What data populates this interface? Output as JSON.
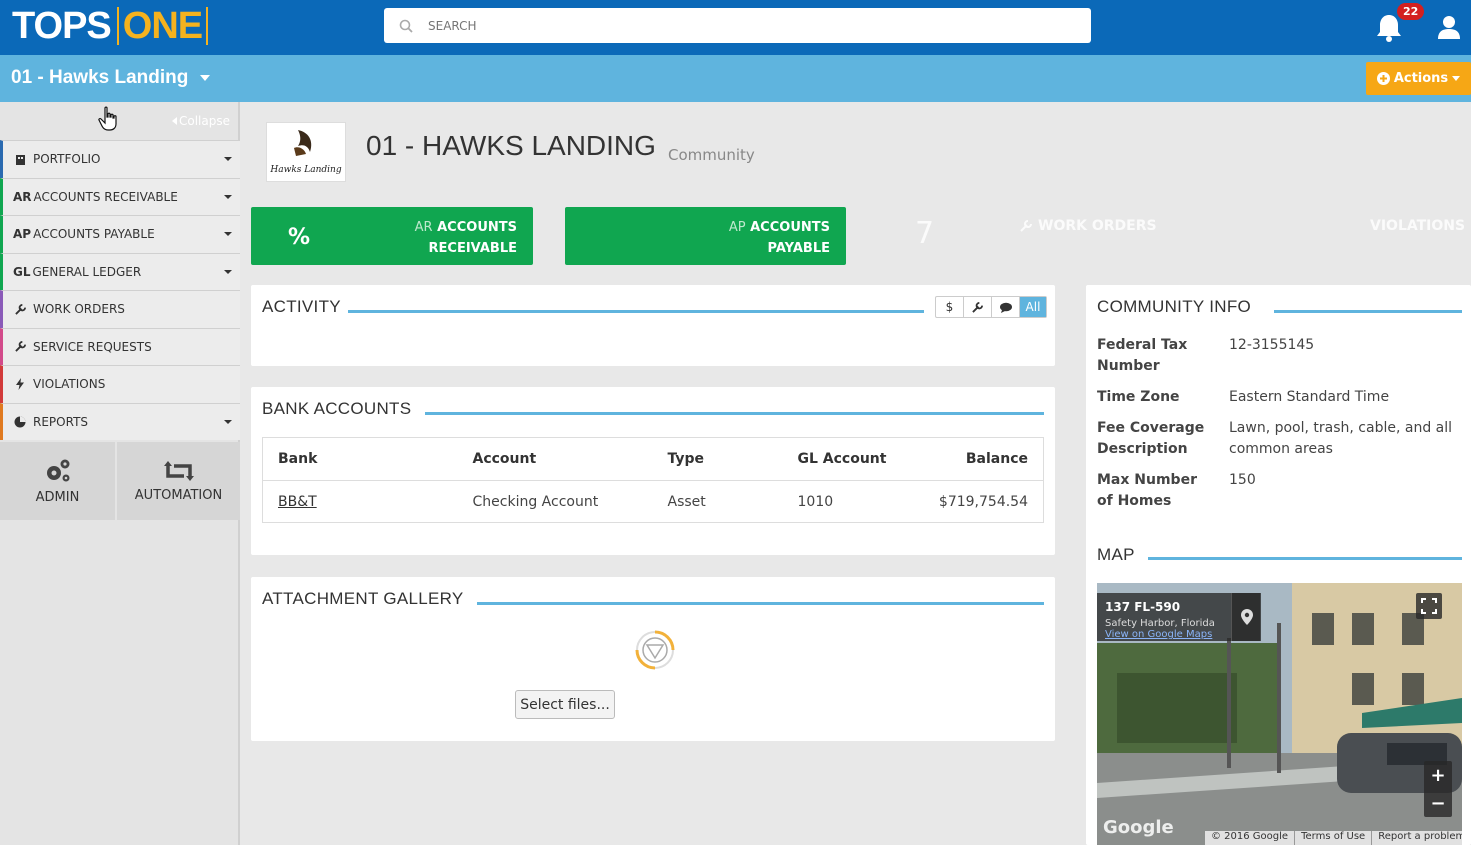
{
  "topbar": {
    "logo_left": "TOPS",
    "logo_right": "ONE",
    "search_placeholder": "SEARCH",
    "notification_count": "22"
  },
  "subbar": {
    "community": "01 - Hawks Landing",
    "actions_label": "Actions"
  },
  "sidebar": {
    "collapse_label": "Collapse",
    "items": [
      {
        "prefix": "",
        "label": "PORTFOLIO",
        "icon": "building-icon",
        "accent": "#2a6ab0",
        "has_caret": true
      },
      {
        "prefix": "AR",
        "label": "ACCOUNTS RECEIVABLE",
        "icon": "",
        "accent": "#10a650",
        "has_caret": true
      },
      {
        "prefix": "AP",
        "label": "ACCOUNTS PAYABLE",
        "icon": "",
        "accent": "#10a650",
        "has_caret": true
      },
      {
        "prefix": "GL",
        "label": "GENERAL LEDGER",
        "icon": "",
        "accent": "#10a650",
        "has_caret": true
      },
      {
        "prefix": "",
        "label": "WORK ORDERS",
        "icon": "wrench-icon",
        "accent": "#8a5ab8",
        "has_caret": false
      },
      {
        "prefix": "",
        "label": "SERVICE REQUESTS",
        "icon": "wrench-icon",
        "accent": "#d24a8a",
        "has_caret": false
      },
      {
        "prefix": "",
        "label": "VIOLATIONS",
        "icon": "bolt-icon",
        "accent": "#d23a3a",
        "has_caret": false
      },
      {
        "prefix": "",
        "label": "REPORTS",
        "icon": "pie-chart-icon",
        "accent": "#e07a20",
        "has_caret": true
      }
    ],
    "tiles": [
      {
        "label": "ADMIN",
        "icon": "gears-icon"
      },
      {
        "label": "AUTOMATION",
        "icon": "retweet-icon"
      }
    ]
  },
  "header": {
    "title": "01 - HAWKS LANDING",
    "subtitle": "Community",
    "logo_text": "Hawks Landing"
  },
  "stats": {
    "ar": {
      "value": "%",
      "prefix": "AR",
      "line1": "ACCOUNTS",
      "line2": "RECEIVABLE"
    },
    "ap": {
      "prefix": "AP",
      "line1": "ACCOUNTS",
      "line2": "PAYABLE"
    },
    "count": "7",
    "work_orders": "WORK ORDERS",
    "violations": "VIOLATIONS"
  },
  "activity": {
    "title": "ACTIVITY",
    "filters": [
      "$",
      "wrench",
      "comment",
      "All"
    ]
  },
  "bank_accounts": {
    "title": "BANK ACCOUNTS",
    "columns": [
      "Bank",
      "Account",
      "Type",
      "GL Account",
      "Balance"
    ],
    "rows": [
      {
        "bank": "BB&T",
        "account": "Checking Account",
        "type": "Asset",
        "gl": "1010",
        "balance": "$719,754.54"
      }
    ]
  },
  "attachments": {
    "title": "ATTACHMENT GALLERY",
    "button": "Select files..."
  },
  "community_info": {
    "title": "COMMUNITY INFO",
    "fields": [
      {
        "label": "Federal Tax Number",
        "value": "12-3155145"
      },
      {
        "label": "Time Zone",
        "value": "Eastern Standard Time"
      },
      {
        "label": "Fee Coverage Description",
        "value": "Lawn, pool, trash, cable, and all common areas"
      },
      {
        "label": "Max Number of Homes",
        "value": "150"
      }
    ]
  },
  "map": {
    "title": "MAP",
    "address": "137 FL-590",
    "location": "Safety Harbor, Florida",
    "link": "View on Google Maps",
    "brand": "Google",
    "copyright": "© 2016 Google",
    "terms": "Terms of Use",
    "report": "Report a problem"
  }
}
